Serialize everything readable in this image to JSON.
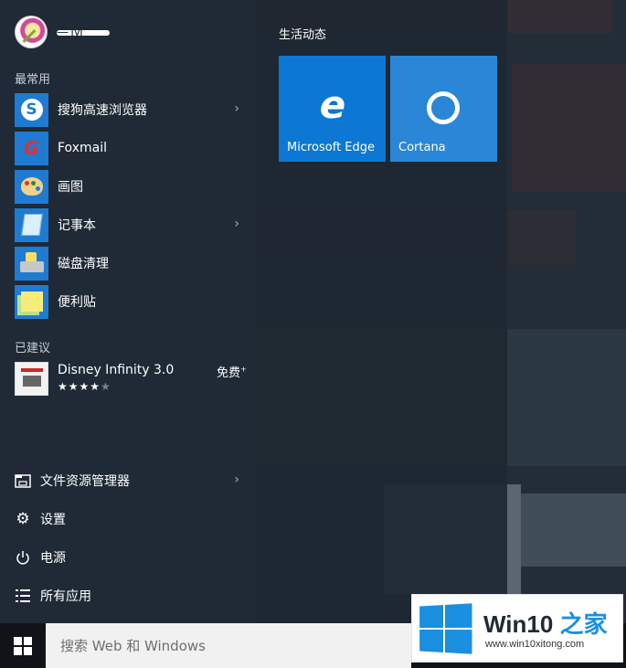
{
  "user": {
    "name": "— fyl"
  },
  "most_used": {
    "title": "最常用",
    "items": [
      {
        "label": "搜狗高速浏览器",
        "icon": "sogou-browser-icon",
        "has_submenu": true
      },
      {
        "label": "Foxmail",
        "icon": "foxmail-icon",
        "has_submenu": false
      },
      {
        "label": "画图",
        "icon": "paint-icon",
        "has_submenu": false
      },
      {
        "label": "记事本",
        "icon": "notepad-icon",
        "has_submenu": true
      },
      {
        "label": "磁盘清理",
        "icon": "disk-cleanup-icon",
        "has_submenu": false
      },
      {
        "label": "便利贴",
        "icon": "sticky-notes-icon",
        "has_submenu": false
      }
    ]
  },
  "suggested": {
    "title": "已建议",
    "item": {
      "name": "Disney Infinity 3.0",
      "price": "免费",
      "price_mark": "+",
      "stars_on": "★★★★",
      "stars_off": "★",
      "rating": 4,
      "rating_max": 5
    }
  },
  "bottom": {
    "file_explorer": "文件资源管理器",
    "settings": "设置",
    "power": "电源",
    "all_apps": "所有应用"
  },
  "tiles": {
    "title": "生活动态",
    "edge": "Microsoft Edge",
    "cortana": "Cortana"
  },
  "taskbar": {
    "search_placeholder": "搜索 Web 和 Windows"
  },
  "watermark": {
    "brand": "Win10",
    "brand_suffix": "之家",
    "url": "www.win10xitong.com"
  },
  "colors": {
    "tile_edge": "#0c78d4",
    "tile_cortana": "#2a86d6",
    "menu_bg": "#1f2a36"
  }
}
